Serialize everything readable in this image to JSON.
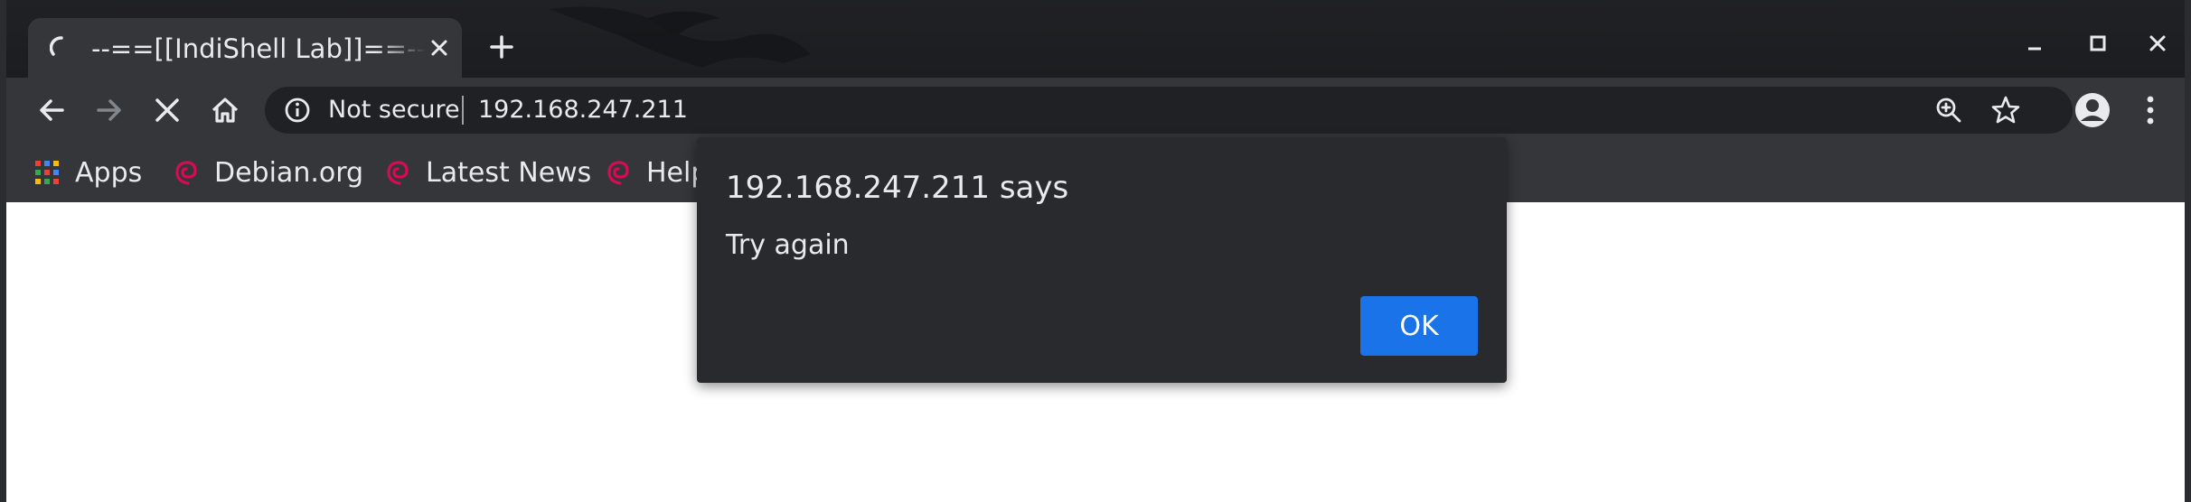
{
  "tab": {
    "title": "--==[[IndiShell Lab]]==--",
    "close_icon": "close-icon",
    "loading_icon": "spinner-icon"
  },
  "new_tab_icon": "plus-icon",
  "window_controls": {
    "minimize_icon": "minimize-icon",
    "maximize_icon": "maximize-icon",
    "close_icon": "close-icon"
  },
  "toolbar": {
    "back_icon": "arrow-left-icon",
    "forward_icon": "arrow-right-icon",
    "stop_icon": "close-icon",
    "home_icon": "home-icon",
    "security_label": "Not secure",
    "url": "192.168.247.211",
    "zoom_icon": "zoom-in-icon",
    "bookmark_icon": "star-icon",
    "profile_icon": "account-circle-icon",
    "menu_icon": "vertical-dots-icon"
  },
  "bookmarks": [
    {
      "label": "Apps",
      "icon": "apps-grid-icon"
    },
    {
      "label": "Debian.org",
      "icon": "debian-swirl-icon"
    },
    {
      "label": "Latest News",
      "icon": "debian-swirl-icon"
    },
    {
      "label": "Help",
      "icon": "debian-swirl-icon"
    }
  ],
  "dialog": {
    "title": "192.168.247.211 says",
    "message": "Try again",
    "ok_label": "OK"
  },
  "colors": {
    "chrome_dark": "#202124",
    "toolbar": "#35363a",
    "dialog_bg": "#292a2d",
    "accent_button": "#1a73e8",
    "debian_red": "#d70a53"
  }
}
